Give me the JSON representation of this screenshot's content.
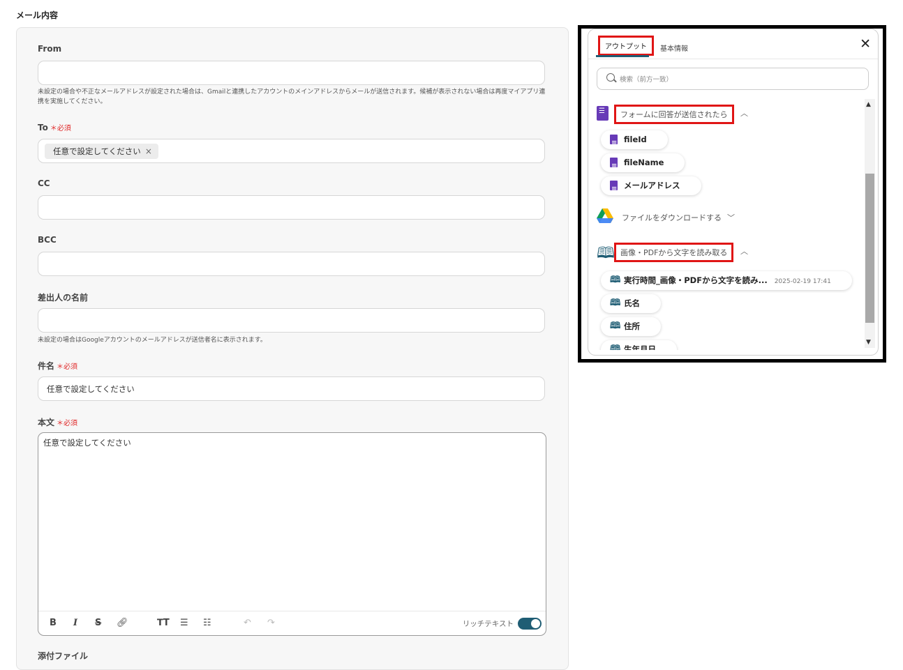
{
  "section_title": "メール内容",
  "form": {
    "from_label": "From",
    "from_help": "未設定の場合や不正なメールアドレスが設定された場合は、Gmailと連携したアカウントのメインアドレスからメールが送信されます。候補が表示されない場合は再度マイアプリ連携を実施してください。",
    "to_label": "To",
    "required": "＊必須",
    "to_chip": "任意で設定してください",
    "to_chip_close": "×",
    "cc_label": "CC",
    "bcc_label": "BCC",
    "sender_label": "差出人の名前",
    "sender_help": "未設定の場合はGoogleアカウントのメールアドレスが送信者名に表示されます。",
    "subject_label": "件名",
    "subject_value": "任意で設定してください",
    "body_label": "本文",
    "body_value": "任意で設定してください",
    "rich_text_label": "リッチテキスト",
    "attachment_label": "添付ファイル"
  },
  "toolbar_icons": [
    "bold-icon",
    "italic-icon",
    "strikethrough-icon",
    "link-icon",
    "text-size-icon",
    "bullet-list-icon",
    "numbered-list-icon",
    "undo-icon",
    "redo-icon"
  ],
  "popup": {
    "tab_output": "アウトプット",
    "tab_basic": "基本情報",
    "close": "✕",
    "search_placeholder": "検索（前方一致）",
    "groups": [
      {
        "title": "フォームに回答が送信されたら",
        "expanded": true,
        "items": [
          {
            "label": "fileId"
          },
          {
            "label": "fileName"
          },
          {
            "label": "メールアドレス"
          }
        ]
      },
      {
        "title": "ファイルをダウンロードする",
        "expanded": false,
        "items": []
      },
      {
        "title": "画像・PDFから文字を読み取る",
        "expanded": true,
        "items": [
          {
            "label": "実行時間_画像・PDFから文字を読み...",
            "timestamp": "2025-02-19 17:41"
          },
          {
            "label": "氏名"
          },
          {
            "label": "住所"
          },
          {
            "label": "生年月日"
          }
        ]
      }
    ]
  },
  "colors": {
    "accent": "#1f5d74",
    "highlight_box": "#e01515",
    "forms_purple": "#673ab7",
    "required_red": "#e02828"
  }
}
